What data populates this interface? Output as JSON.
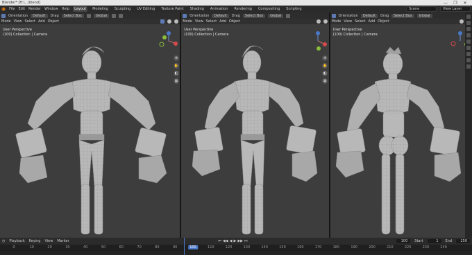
{
  "app": {
    "window_title": "Blender* [H:\\...\\blend]",
    "window_controls": [
      "—",
      "❐",
      "✕"
    ]
  },
  "topbar": {
    "menus": [
      "File",
      "Edit",
      "Render",
      "Window",
      "Help"
    ],
    "tabs": [
      "Layout",
      "Modeling",
      "Sculpting",
      "UV Editing",
      "Texture Paint",
      "Shading",
      "Animation",
      "Rendering",
      "Compositing",
      "Scripting"
    ],
    "active_tab": "Layout",
    "scene_label": "Scene",
    "view_layer_label": "View Layer"
  },
  "viewports": [
    {
      "orientation_label": "Orientation",
      "orientation_value": "Default",
      "drag_label": "Drag",
      "select_label": "Select Box",
      "transform_value": "Global",
      "menus": [
        "Mode",
        "View",
        "Select",
        "Add",
        "Object"
      ],
      "info_line1": "User Perspective",
      "info_line2": "(100) Collection | Camera"
    },
    {
      "orientation_label": "Orientation",
      "orientation_value": "Default",
      "drag_label": "Drag",
      "select_label": "Select Box",
      "transform_value": "Global",
      "menus": [
        "Mode",
        "View",
        "Select",
        "Add",
        "Object"
      ],
      "info_line1": "User Perspective",
      "info_line2": "(100) Collection | Camera"
    },
    {
      "orientation_label": "Orientation",
      "orientation_value": "Default",
      "drag_label": "Drag",
      "select_label": "Select Box",
      "transform_value": "Global",
      "menus": [
        "Mode",
        "View",
        "Select",
        "Add",
        "Object"
      ],
      "info_line1": "User Perspective",
      "info_line2": "(100) Collection | Camera"
    }
  ],
  "timeline": {
    "menus": [
      "Playback",
      "Keying",
      "View",
      "Marker"
    ],
    "current_frame": "100",
    "start_label": "Start",
    "start_value": "1",
    "end_label": "End",
    "end_value": "250",
    "ruler": [
      "0",
      "10",
      "20",
      "30",
      "40",
      "50",
      "60",
      "70",
      "80",
      "90",
      "100",
      "110",
      "120",
      "130",
      "140",
      "150",
      "160",
      "170",
      "180",
      "190",
      "200",
      "210",
      "220",
      "230",
      "240"
    ]
  },
  "colors": {
    "accent": "#4a79c9",
    "viewport_bg": "#3d3d3d",
    "header_bg": "#2d2d2d",
    "mesh": "#b7b7b7"
  }
}
